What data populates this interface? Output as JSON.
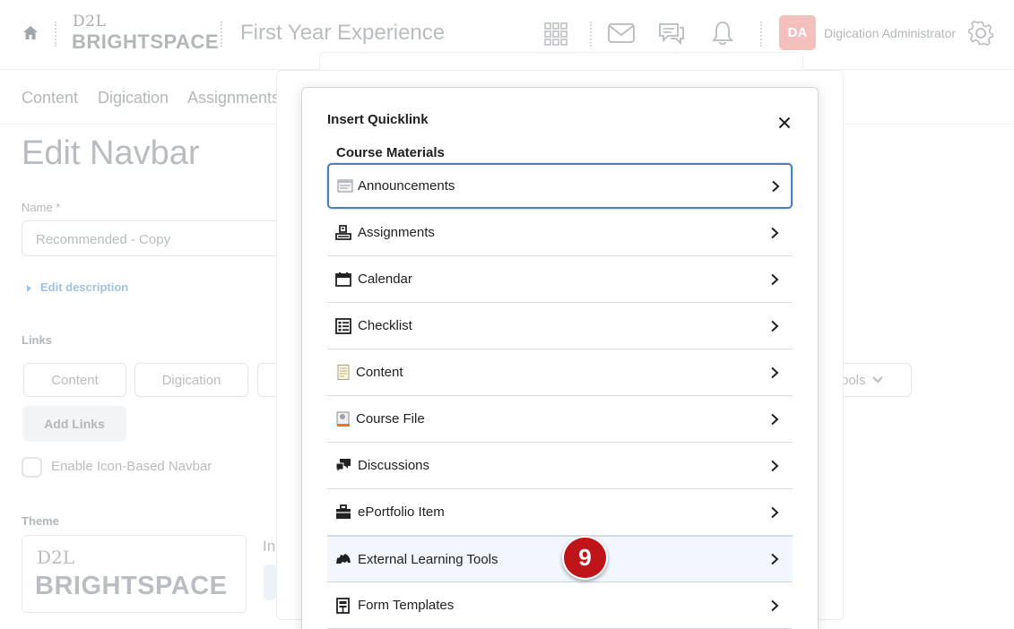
{
  "header": {
    "logo_top": "D2L",
    "logo_main": "BRIGHTSPACE",
    "course_title": "First Year Experience",
    "avatar_initials": "DA",
    "user_name": "Digication Administrator"
  },
  "navbar": {
    "items": [
      "Content",
      "Digication",
      "Assignments"
    ]
  },
  "page": {
    "title": "Edit Navbar",
    "name_label": "Name *",
    "name_value": "Recommended - Copy",
    "edit_description": "Edit description",
    "links_label": "Links",
    "link_chips": [
      "Content",
      "Digication",
      "ools"
    ],
    "add_links": "Add Links",
    "icon_navbar_label": "Enable Icon-Based Navbar",
    "theme_label": "Theme",
    "theme_logo_top": "D2L",
    "theme_logo_main": "BRIGHTSPACE",
    "theme_side_text": "In"
  },
  "modal": {
    "title": "Insert Quicklink",
    "section": "Course Materials",
    "items": [
      {
        "label": "Announcements",
        "icon": "announcements-icon",
        "state": "focused"
      },
      {
        "label": "Assignments",
        "icon": "assignments-icon",
        "state": "normal"
      },
      {
        "label": "Calendar",
        "icon": "calendar-icon",
        "state": "normal"
      },
      {
        "label": "Checklist",
        "icon": "checklist-icon",
        "state": "normal"
      },
      {
        "label": "Content",
        "icon": "content-icon",
        "state": "normal"
      },
      {
        "label": "Course File",
        "icon": "course-file-icon",
        "state": "normal"
      },
      {
        "label": "Discussions",
        "icon": "discussions-icon",
        "state": "normal"
      },
      {
        "label": "ePortfolio Item",
        "icon": "eportfolio-icon",
        "state": "normal"
      },
      {
        "label": "External Learning Tools",
        "icon": "external-tools-icon",
        "state": "hover"
      },
      {
        "label": "Form Templates",
        "icon": "form-templates-icon",
        "state": "normal"
      }
    ]
  },
  "step_badge": "9",
  "colors": {
    "focus_border": "#4f7fb6",
    "hover_bg": "#f2f7fd",
    "badge": "#c0141b",
    "avatar": "#f3c0bd"
  }
}
